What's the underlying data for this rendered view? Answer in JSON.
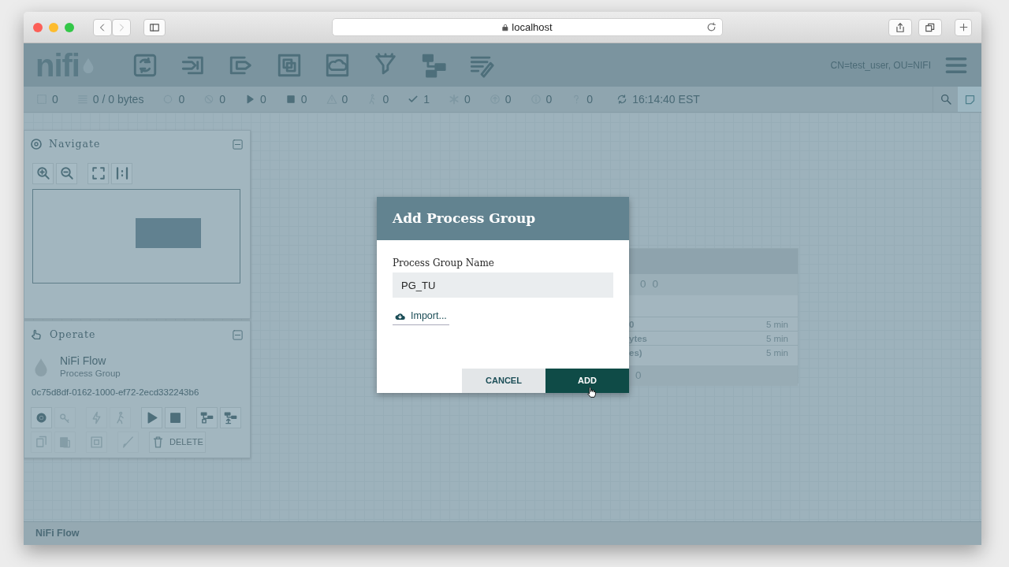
{
  "browser": {
    "address": "localhost"
  },
  "header": {
    "logo": "nifi",
    "user": "CN=test_user, OU=NIFI"
  },
  "status_bar": [
    {
      "value": "0"
    },
    {
      "value": "0 / 0 bytes"
    },
    {
      "value": "0"
    },
    {
      "value": "0"
    },
    {
      "value": "0"
    },
    {
      "value": "0"
    },
    {
      "value": "0"
    },
    {
      "value": "0"
    },
    {
      "value": "1"
    },
    {
      "value": "0"
    },
    {
      "value": "0"
    },
    {
      "value": "0"
    },
    {
      "value": "0"
    },
    {
      "value": "16:14:40 EST"
    }
  ],
  "navigate": {
    "title": "Navigate"
  },
  "operate": {
    "title": "Operate",
    "name": "NiFi Flow",
    "type": "Process Group",
    "id": "0c75d8df-0162-1000-ef72-2ecd332243b6",
    "buttons": [
      {
        "disabled": false
      },
      {
        "disabled": true
      },
      {
        "disabled": true
      },
      {
        "disabled": true
      },
      {
        "disabled": false
      },
      {
        "disabled": false
      },
      {
        "disabled": false
      },
      {
        "disabled": false
      },
      {
        "disabled": true
      },
      {
        "disabled": true
      },
      {
        "disabled": true
      },
      {
        "disabled": true
      },
      {
        "disabled": true,
        "label": "DELETE"
      }
    ]
  },
  "process_group": {
    "counts": [
      "0",
      "0"
    ],
    "rows": [
      {
        "label": "0",
        "time": "5 min"
      },
      {
        "label": "ytes",
        "time": "5 min"
      },
      {
        "label": "es)",
        "time": "5 min"
      }
    ],
    "footer": "0"
  },
  "dialog": {
    "title": "Add Process Group",
    "field_label": "Process Group Name",
    "value": "PG_TU",
    "import_link": "Import...",
    "buttons": [
      {
        "label": "CANCEL",
        "primary": false
      },
      {
        "label": "ADD",
        "primary": true
      }
    ]
  },
  "breadcrumb": "NiFi Flow"
}
